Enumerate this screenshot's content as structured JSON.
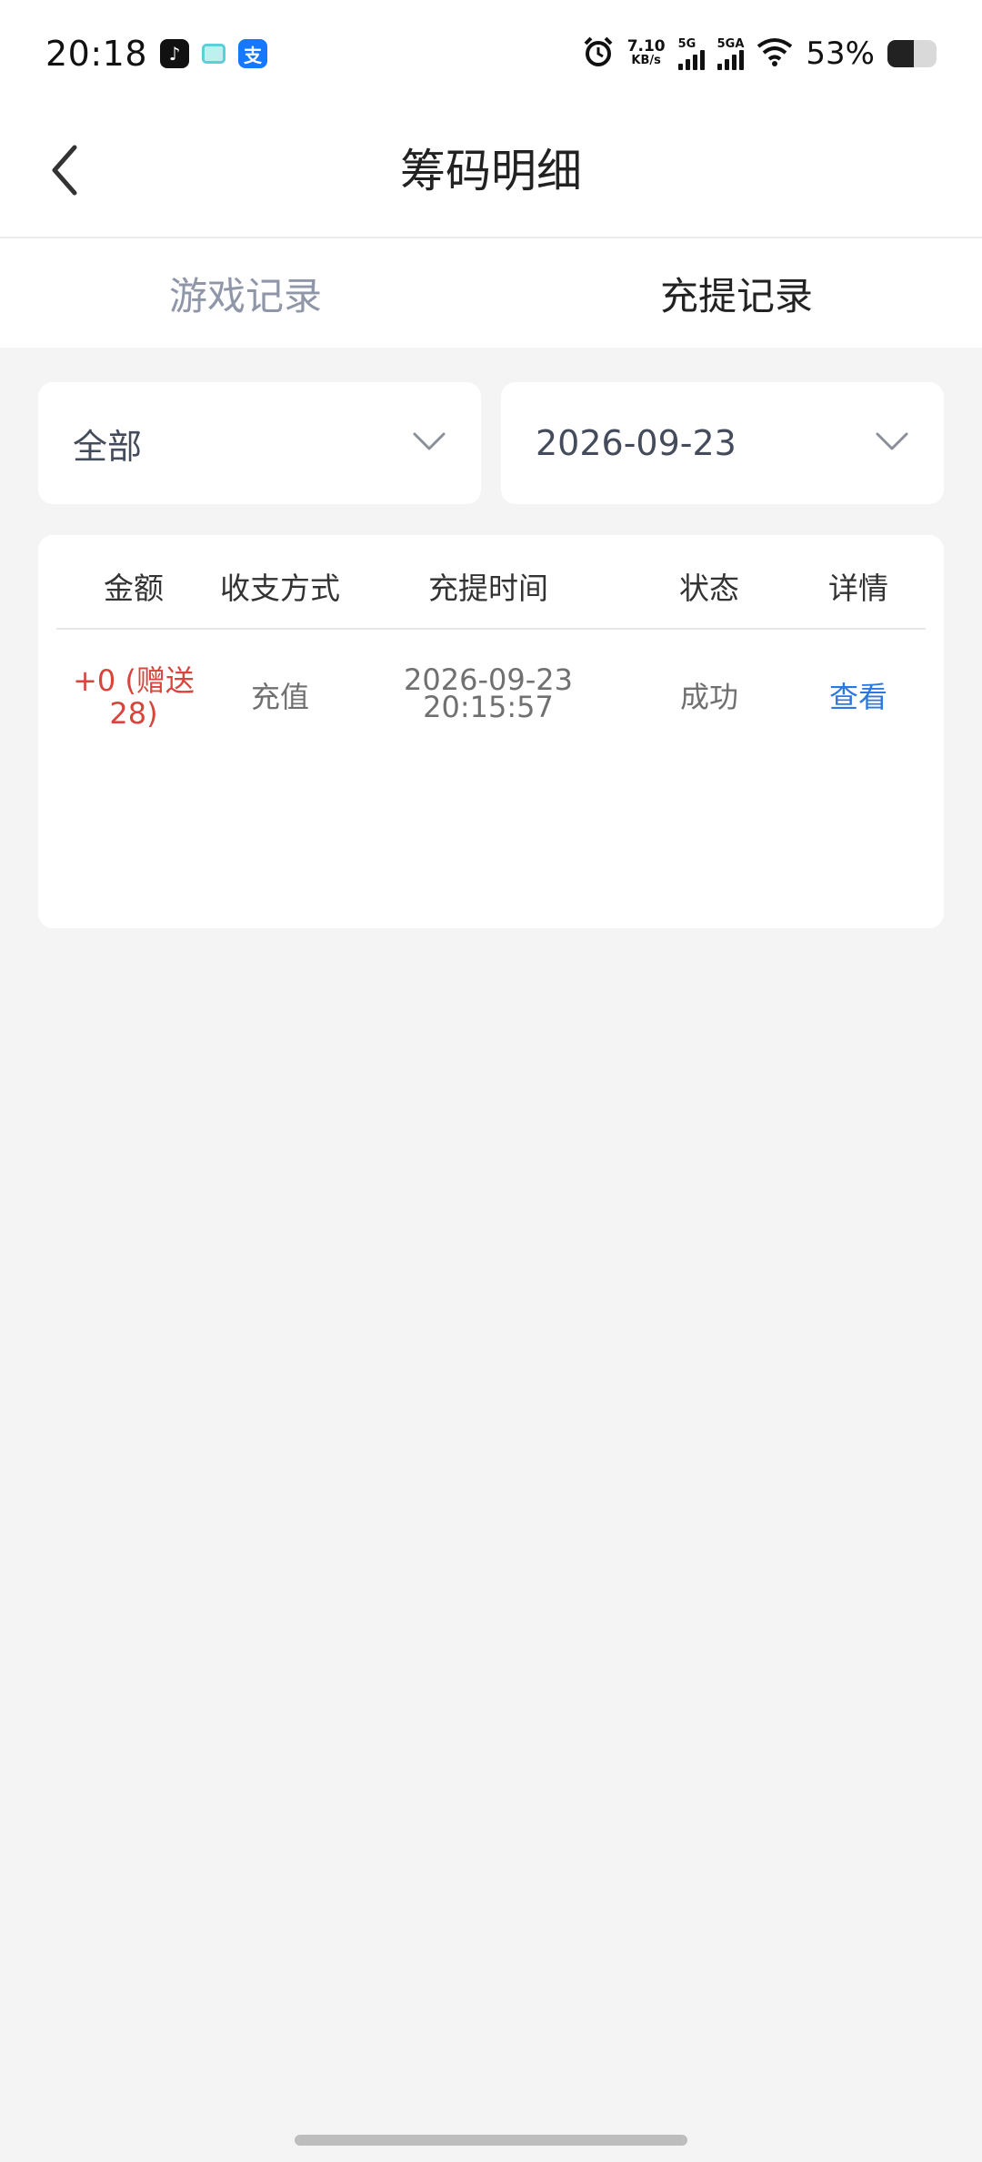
{
  "status_bar": {
    "time": "20:18",
    "net_speed_value": "7.10",
    "net_speed_unit": "KB/s",
    "signal1_label": "5G",
    "signal2_label": "5GA",
    "battery_percent": "53%",
    "battery_level": 0.53,
    "icons": [
      "tiktok-icon",
      "message-icon",
      "alipay-icon",
      "alarm-icon",
      "wifi-icon",
      "battery-icon"
    ]
  },
  "header": {
    "title": "筹码明细",
    "back_icon": "chevron-left-icon"
  },
  "tabs": [
    {
      "label": "游戏记录",
      "active": false
    },
    {
      "label": "充提记录",
      "active": true
    }
  ],
  "filters": {
    "type": {
      "value": "全部",
      "icon": "chevron-down-icon"
    },
    "date": {
      "value": "2026-09-23",
      "icon": "chevron-down-icon"
    }
  },
  "table": {
    "columns": [
      "金额",
      "收支方式",
      "充提时间",
      "状态",
      "详情"
    ],
    "rows": [
      {
        "amount": "+0 (赠送28)",
        "method": "充值",
        "date": "2026-09-23",
        "time": "20:15:57",
        "status": "成功",
        "detail": "查看"
      }
    ]
  },
  "colors": {
    "accent_blue": "#2b78e4",
    "amount_red": "#d8453c",
    "inactive_tab": "#8f96a8",
    "background": "#f4f4f5"
  }
}
